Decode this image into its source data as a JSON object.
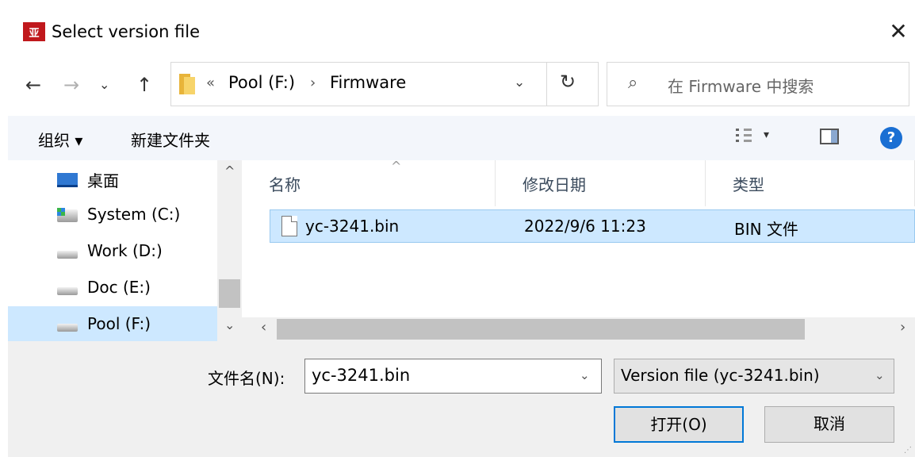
{
  "window": {
    "title": "Select version file",
    "app_icon_text": "亚",
    "close_glyph": "✕"
  },
  "nav": {
    "back_glyph": "←",
    "forward_glyph": "→",
    "recent_glyph": "⌄",
    "up_glyph": "↑",
    "breadcrumb_overflow": "«",
    "breadcrumb": [
      "Pool (F:)",
      "Firmware"
    ],
    "breadcrumb_sep": "›",
    "address_dropdown_glyph": "⌄",
    "refresh_glyph": "↻",
    "search_glyph": "⌕",
    "search_placeholder": "在 Firmware 中搜索"
  },
  "toolbar": {
    "organize_label": "组织 ▾",
    "new_folder_label": "新建文件夹",
    "view_dropdown_glyph": "▾",
    "help_label": "?"
  },
  "sidebar": {
    "scroll_up_glyph": "^",
    "scroll_down_glyph": "⌄",
    "items": [
      {
        "label": "桌面",
        "icon": "desktop-icon",
        "selected": false
      },
      {
        "label": "System (C:)",
        "icon": "system-drive-icon",
        "selected": false
      },
      {
        "label": "Work (D:)",
        "icon": "drive-icon",
        "selected": false
      },
      {
        "label": "Doc (E:)",
        "icon": "drive-icon",
        "selected": false
      },
      {
        "label": "Pool (F:)",
        "icon": "drive-icon",
        "selected": true
      }
    ]
  },
  "file_list": {
    "sort_glyph": "^",
    "columns": [
      "名称",
      "修改日期",
      "类型"
    ],
    "rows": [
      {
        "name": "yc-3241.bin",
        "modified": "2022/9/6 11:23",
        "type": "BIN 文件",
        "selected": true
      }
    ],
    "scroll_left_glyph": "‹",
    "scroll_right_glyph": "›"
  },
  "footer": {
    "filename_label": "文件名(N):",
    "filename_value": "yc-3241.bin",
    "filename_dropdown_glyph": "⌄",
    "filter_value": "Version file  (yc-3241.bin)",
    "filter_dropdown_glyph": "⌄",
    "open_label": "打开(O)",
    "cancel_label": "取消"
  },
  "colors": {
    "selection": "#cde8ff",
    "accent": "#0078d7",
    "toolbar_bg": "#f3f6fb"
  }
}
